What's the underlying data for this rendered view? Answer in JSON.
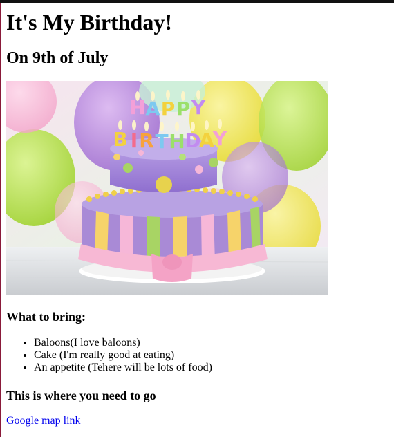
{
  "page": {
    "title": "It's My Birthday!",
    "subtitle": "On 9th of July"
  },
  "hero_image": {
    "alt": "Birthday cake with Happy Birthday candles",
    "candle_letters": {
      "line1": "HAPPY",
      "line2": "BIRTHDAY"
    }
  },
  "bring": {
    "heading": "What to bring:",
    "items": [
      "Baloons(I love baloons)",
      "Cake (I'm really good at eating)",
      "An appetite (Tehere will be lots of food)"
    ]
  },
  "location": {
    "heading": "This is where you need to go",
    "link_text": "Google map link"
  },
  "colors": {
    "link": "#0000ee",
    "text": "#000000",
    "top_bar": "#111111"
  }
}
